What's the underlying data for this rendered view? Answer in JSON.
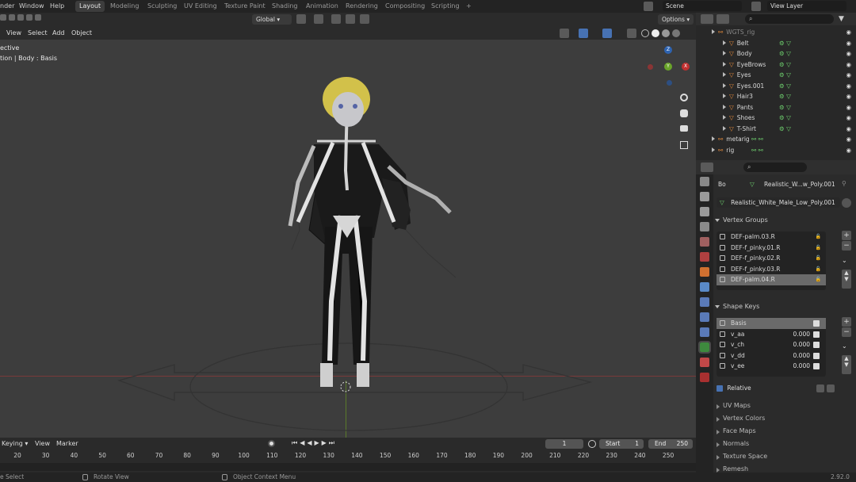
{
  "top_menu": [
    "nder",
    "Window",
    "Help"
  ],
  "workspaces": [
    {
      "label": "Layout",
      "active": true
    },
    {
      "label": "Modeling"
    },
    {
      "label": "Sculpting"
    },
    {
      "label": "UV Editing"
    },
    {
      "label": "Texture Paint"
    },
    {
      "label": "Shading"
    },
    {
      "label": "Animation"
    },
    {
      "label": "Rendering"
    },
    {
      "label": "Compositing"
    },
    {
      "label": "Scripting"
    },
    {
      "label": "+"
    }
  ],
  "scene": "Scene",
  "view_layer": "View Layer",
  "viewport_header": {
    "menus": [
      "View",
      "Select",
      "Add",
      "Object"
    ],
    "transform_orientation": "Global",
    "options": "Options"
  },
  "viewport_info": {
    "line1": "ective",
    "line2": "tion | Body : Basis"
  },
  "gizmo": {
    "z": "Z",
    "x": "X",
    "y": "Y"
  },
  "outliner": {
    "rows": [
      {
        "label": "WGTS_rig",
        "indent": 1,
        "faded": true
      },
      {
        "label": "Belt",
        "indent": 2
      },
      {
        "label": "Body",
        "indent": 2
      },
      {
        "label": "EyeBrows",
        "indent": 2
      },
      {
        "label": "Eyes",
        "indent": 2
      },
      {
        "label": "Eyes.001",
        "indent": 2
      },
      {
        "label": "Hair3",
        "indent": 2
      },
      {
        "label": "Pants",
        "indent": 2
      },
      {
        "label": "Shoes",
        "indent": 2
      },
      {
        "label": "T-Shirt",
        "indent": 2
      },
      {
        "label": "metarig",
        "indent": 1
      },
      {
        "label": "rig",
        "indent": 1
      }
    ]
  },
  "properties": {
    "object_short": "Bo",
    "mesh_short": "Realistic_W...w_Poly.001",
    "mesh_name": "Realistic_White_Male_Low_Poly.001",
    "vertex_groups_title": "Vertex Groups",
    "vertex_groups": [
      "DEF-palm.03.R",
      "DEF-f_pinky.01.R",
      "DEF-f_pinky.02.R",
      "DEF-f_pinky.03.R",
      "DEF-palm.04.R"
    ],
    "vertex_groups_selected": 4,
    "shape_keys_title": "Shape Keys",
    "shape_keys": [
      {
        "name": "Basis",
        "value": ""
      },
      {
        "name": "v_aa",
        "value": "0.000"
      },
      {
        "name": "v_ch",
        "value": "0.000"
      },
      {
        "name": "v_dd",
        "value": "0.000"
      },
      {
        "name": "v_ee",
        "value": "0.000"
      }
    ],
    "relative": "Relative",
    "sections": [
      "UV Maps",
      "Vertex Colors",
      "Face Maps",
      "Normals",
      "Texture Space",
      "Remesh"
    ]
  },
  "timeline": {
    "keying": "Keying",
    "view": "View",
    "marker": "Marker",
    "current_frame": "1",
    "start_label": "Start",
    "start": "1",
    "end_label": "End",
    "end": "250",
    "ticks": [
      "20",
      "30",
      "40",
      "50",
      "60",
      "70",
      "80",
      "90",
      "100",
      "110",
      "120",
      "130",
      "140",
      "150",
      "160",
      "170",
      "180",
      "190",
      "200",
      "210",
      "220",
      "230",
      "240",
      "250"
    ]
  },
  "status_bar": {
    "left": "e Select",
    "mid1": "Rotate View",
    "mid2": "Object Context Menu",
    "version": "2.92.0"
  },
  "colors": {
    "accent": "#4772b3",
    "red_axis": "#8a3b3b",
    "green_axis": "#5a7a2a",
    "active_ws": "#3d3d3d"
  }
}
